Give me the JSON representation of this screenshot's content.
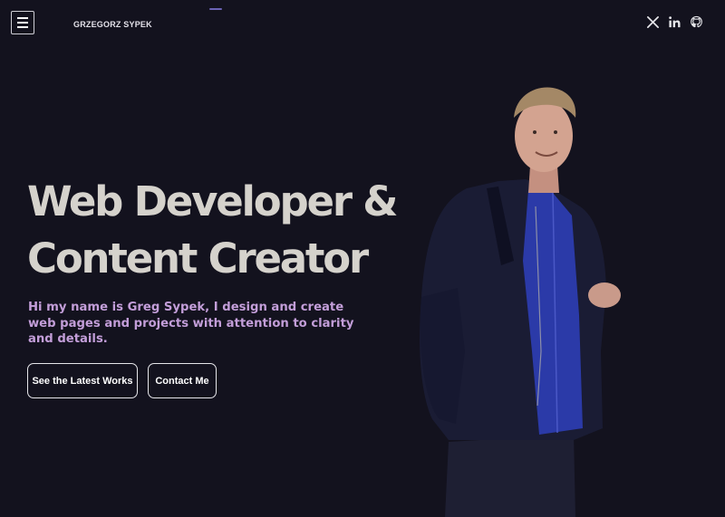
{
  "header": {
    "brand": "GRZEGORZ SYPEK",
    "menu_icon": "hamburger-menu-icon",
    "social": [
      {
        "name": "X",
        "icon": "x-twitter-icon"
      },
      {
        "name": "LinkedIn",
        "icon": "linkedin-icon"
      },
      {
        "name": "GitHub",
        "icon": "github-icon"
      }
    ]
  },
  "hero": {
    "headline_line1": "Web Developer &",
    "headline_line2": "Content Creator",
    "intro": "Hi my name is Greg Sypek, I design and create web pages and projects with attention to clarity and details.",
    "primary_cta": "See the Latest Works",
    "secondary_cta": "Contact Me"
  },
  "colors": {
    "background": "#13121e",
    "headline": "#d5d2cc",
    "intro_text": "#c39ed9",
    "accent": "#6b63b5",
    "button_border": "#e6e6ea"
  }
}
